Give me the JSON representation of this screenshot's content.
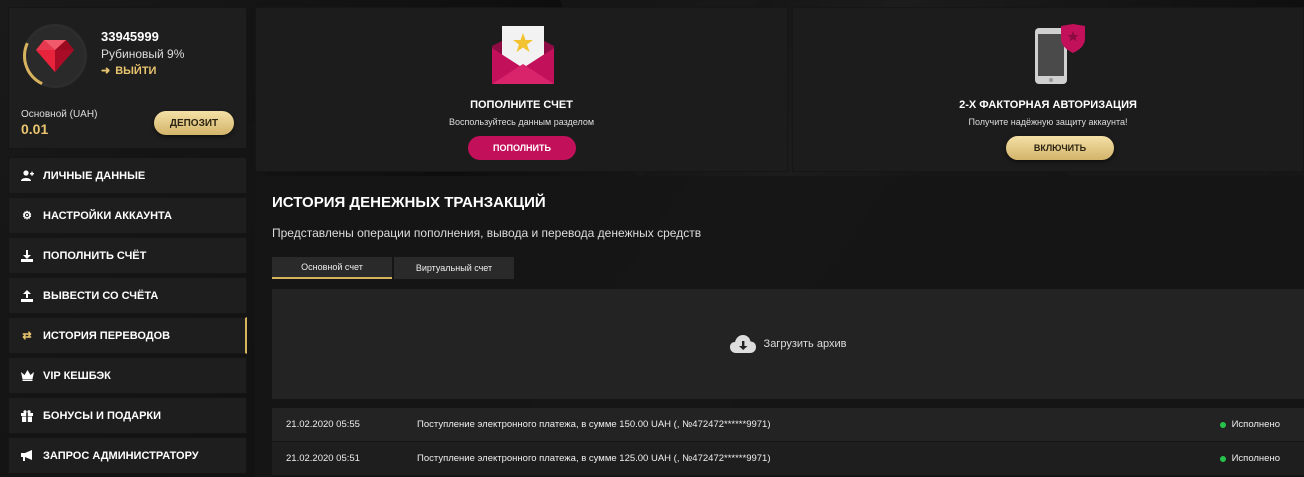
{
  "profile": {
    "user_id": "33945999",
    "level": "Рубиновый 9%",
    "logout_label": "ВЫЙТИ",
    "balance_label": "Основной (UAH)",
    "balance_value": "0.01",
    "deposit_label": "ДЕПОЗИТ"
  },
  "menu": {
    "items": [
      {
        "label": "ЛИЧНЫЕ ДАННЫЕ",
        "icon": "user-plus-icon"
      },
      {
        "label": "НАСТРОЙКИ АККАУНТА",
        "icon": "gears-icon"
      },
      {
        "label": "ПОПОЛНИТЬ СЧЁТ",
        "icon": "download-icon"
      },
      {
        "label": "ВЫВЕСТИ СО СЧЁТА",
        "icon": "upload-icon"
      },
      {
        "label": "ИСТОРИЯ ПЕРЕВОДОВ",
        "icon": "exchange-icon",
        "active": true
      },
      {
        "label": "VIP КЕШБЭК",
        "icon": "crown-icon"
      },
      {
        "label": "БОНУСЫ И ПОДАРКИ",
        "icon": "gift-icon"
      },
      {
        "label": "ЗАПРОС АДМИНИСТРАТОРУ",
        "icon": "megaphone-icon"
      }
    ]
  },
  "cards": {
    "deposit": {
      "title": "ПОПОЛНИТЕ СЧЕТ",
      "subtitle": "Воспользуйтесь данным разделом",
      "button": "ПОПОЛНИТЬ"
    },
    "twofa": {
      "title": "2-Х ФАКТОРНАЯ АВТОРИЗАЦИЯ",
      "subtitle": "Получите надёжную защиту аккаунта!",
      "button": "ВКЛЮЧИТЬ"
    }
  },
  "history": {
    "title": "ИСТОРИЯ ДЕНЕЖНЫХ ТРАНЗАКЦИЙ",
    "description": "Представлены операции пополнения, вывода и перевода денежных средств",
    "tabs": [
      "Основной счет",
      "Виртуальный счет"
    ],
    "archive_label": "Загрузить архив",
    "rows": [
      {
        "date": "21.02.2020 05:55",
        "description": "Поступление электронного платежа, в сумме 150.00 UAH (, №472472******9971)",
        "status": "Исполнено"
      },
      {
        "date": "21.02.2020 05:51",
        "description": "Поступление электронного платежа, в сумме 125.00 UAH (, №472472******9971)",
        "status": "Исполнено"
      }
    ]
  },
  "colors": {
    "gold": "#d8b35e",
    "pink": "#c2105a",
    "success": "#27c24c"
  }
}
